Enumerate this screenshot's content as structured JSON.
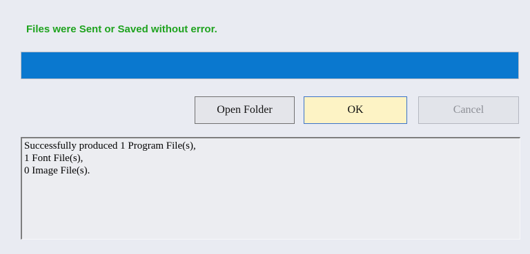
{
  "status": {
    "message": "Files were Sent or Saved without error.",
    "color": "#1fa31f"
  },
  "progress": {
    "fraction": 1.0,
    "fill_color": "#0a78cf"
  },
  "buttons": {
    "open_folder": "Open Folder",
    "ok": "OK",
    "cancel": "Cancel"
  },
  "log": {
    "lines": [
      "Successfully produced 1 Program File(s),",
      "1 Font File(s),",
      "0 Image File(s)."
    ]
  }
}
